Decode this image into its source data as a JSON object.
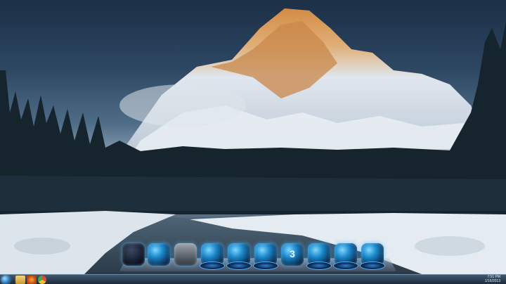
{
  "desktop": {
    "wallpaper": "snowy-mountain-forest-river",
    "colors": {
      "accent": "#2b8fe0",
      "sky": "#2d4763",
      "snow": "#e8eef3",
      "forest": "#16242e"
    }
  },
  "dock": {
    "items": [
      {
        "icon": "shield-icon",
        "label": ""
      },
      {
        "icon": "monitor-icon",
        "label": ""
      },
      {
        "icon": "recycle-bin-icon",
        "label": ""
      },
      {
        "icon": "app-icon-1",
        "label": ""
      },
      {
        "icon": "app-icon-2",
        "label": ""
      },
      {
        "icon": "app-icon-3",
        "label": ""
      },
      {
        "icon": "app-icon-4",
        "label": "3"
      },
      {
        "icon": "app-icon-5",
        "label": ""
      },
      {
        "icon": "app-icon-6",
        "label": ""
      },
      {
        "icon": "app-icon-7",
        "label": ""
      }
    ]
  },
  "taskbar": {
    "pinned": [
      "folder-icon",
      "media-player-icon",
      "chrome-icon"
    ],
    "clock": {
      "time": "7:51 PM",
      "date": "1/16/2013"
    }
  }
}
